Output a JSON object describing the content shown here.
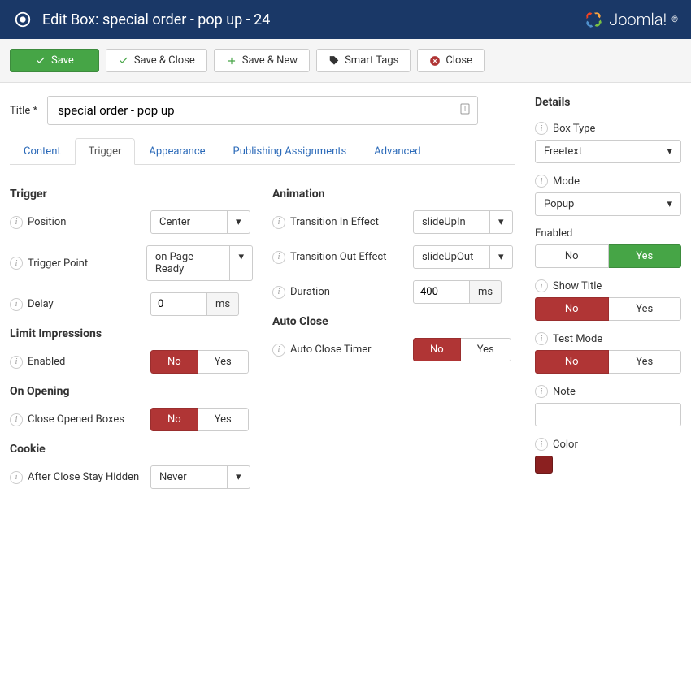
{
  "header": {
    "title": "Edit Box: special order - pop up - 24",
    "brand": "Joomla!"
  },
  "toolbar": {
    "save": "Save",
    "save_close": "Save & Close",
    "save_new": "Save & New",
    "smart_tags": "Smart Tags",
    "close": "Close"
  },
  "title_field": {
    "label": "Title *",
    "value": "special order - pop up"
  },
  "tabs": [
    "Content",
    "Trigger",
    "Appearance",
    "Publishing Assignments",
    "Advanced"
  ],
  "active_tab": "Trigger",
  "trigger": {
    "heading": "Trigger",
    "position_label": "Position",
    "position_value": "Center",
    "trigger_point_label": "Trigger Point",
    "trigger_point_value": "on Page Ready",
    "delay_label": "Delay",
    "delay_value": "0",
    "delay_unit": "ms"
  },
  "limit_impressions": {
    "heading": "Limit Impressions",
    "enabled_label": "Enabled",
    "enabled_no": "No",
    "enabled_yes": "Yes"
  },
  "on_opening": {
    "heading": "On Opening",
    "close_opened_label": "Close Opened Boxes",
    "close_opened_no": "No",
    "close_opened_yes": "Yes"
  },
  "cookie": {
    "heading": "Cookie",
    "after_close_label": "After Close Stay Hidden",
    "after_close_value": "Never"
  },
  "animation": {
    "heading": "Animation",
    "transition_in_label": "Transition In Effect",
    "transition_in_value": "slideUpIn",
    "transition_out_label": "Transition Out Effect",
    "transition_out_value": "slideUpOut",
    "duration_label": "Duration",
    "duration_value": "400",
    "duration_unit": "ms"
  },
  "auto_close": {
    "heading": "Auto Close",
    "timer_label": "Auto Close Timer",
    "timer_no": "No",
    "timer_yes": "Yes"
  },
  "details": {
    "heading": "Details",
    "box_type_label": "Box Type",
    "box_type_value": "Freetext",
    "mode_label": "Mode",
    "mode_value": "Popup",
    "enabled_label": "Enabled",
    "enabled_no": "No",
    "enabled_yes": "Yes",
    "show_title_label": "Show Title",
    "show_title_no": "No",
    "show_title_yes": "Yes",
    "test_mode_label": "Test Mode",
    "test_mode_no": "No",
    "test_mode_yes": "Yes",
    "note_label": "Note",
    "note_value": "",
    "color_label": "Color",
    "color_value": "#8b2020"
  }
}
